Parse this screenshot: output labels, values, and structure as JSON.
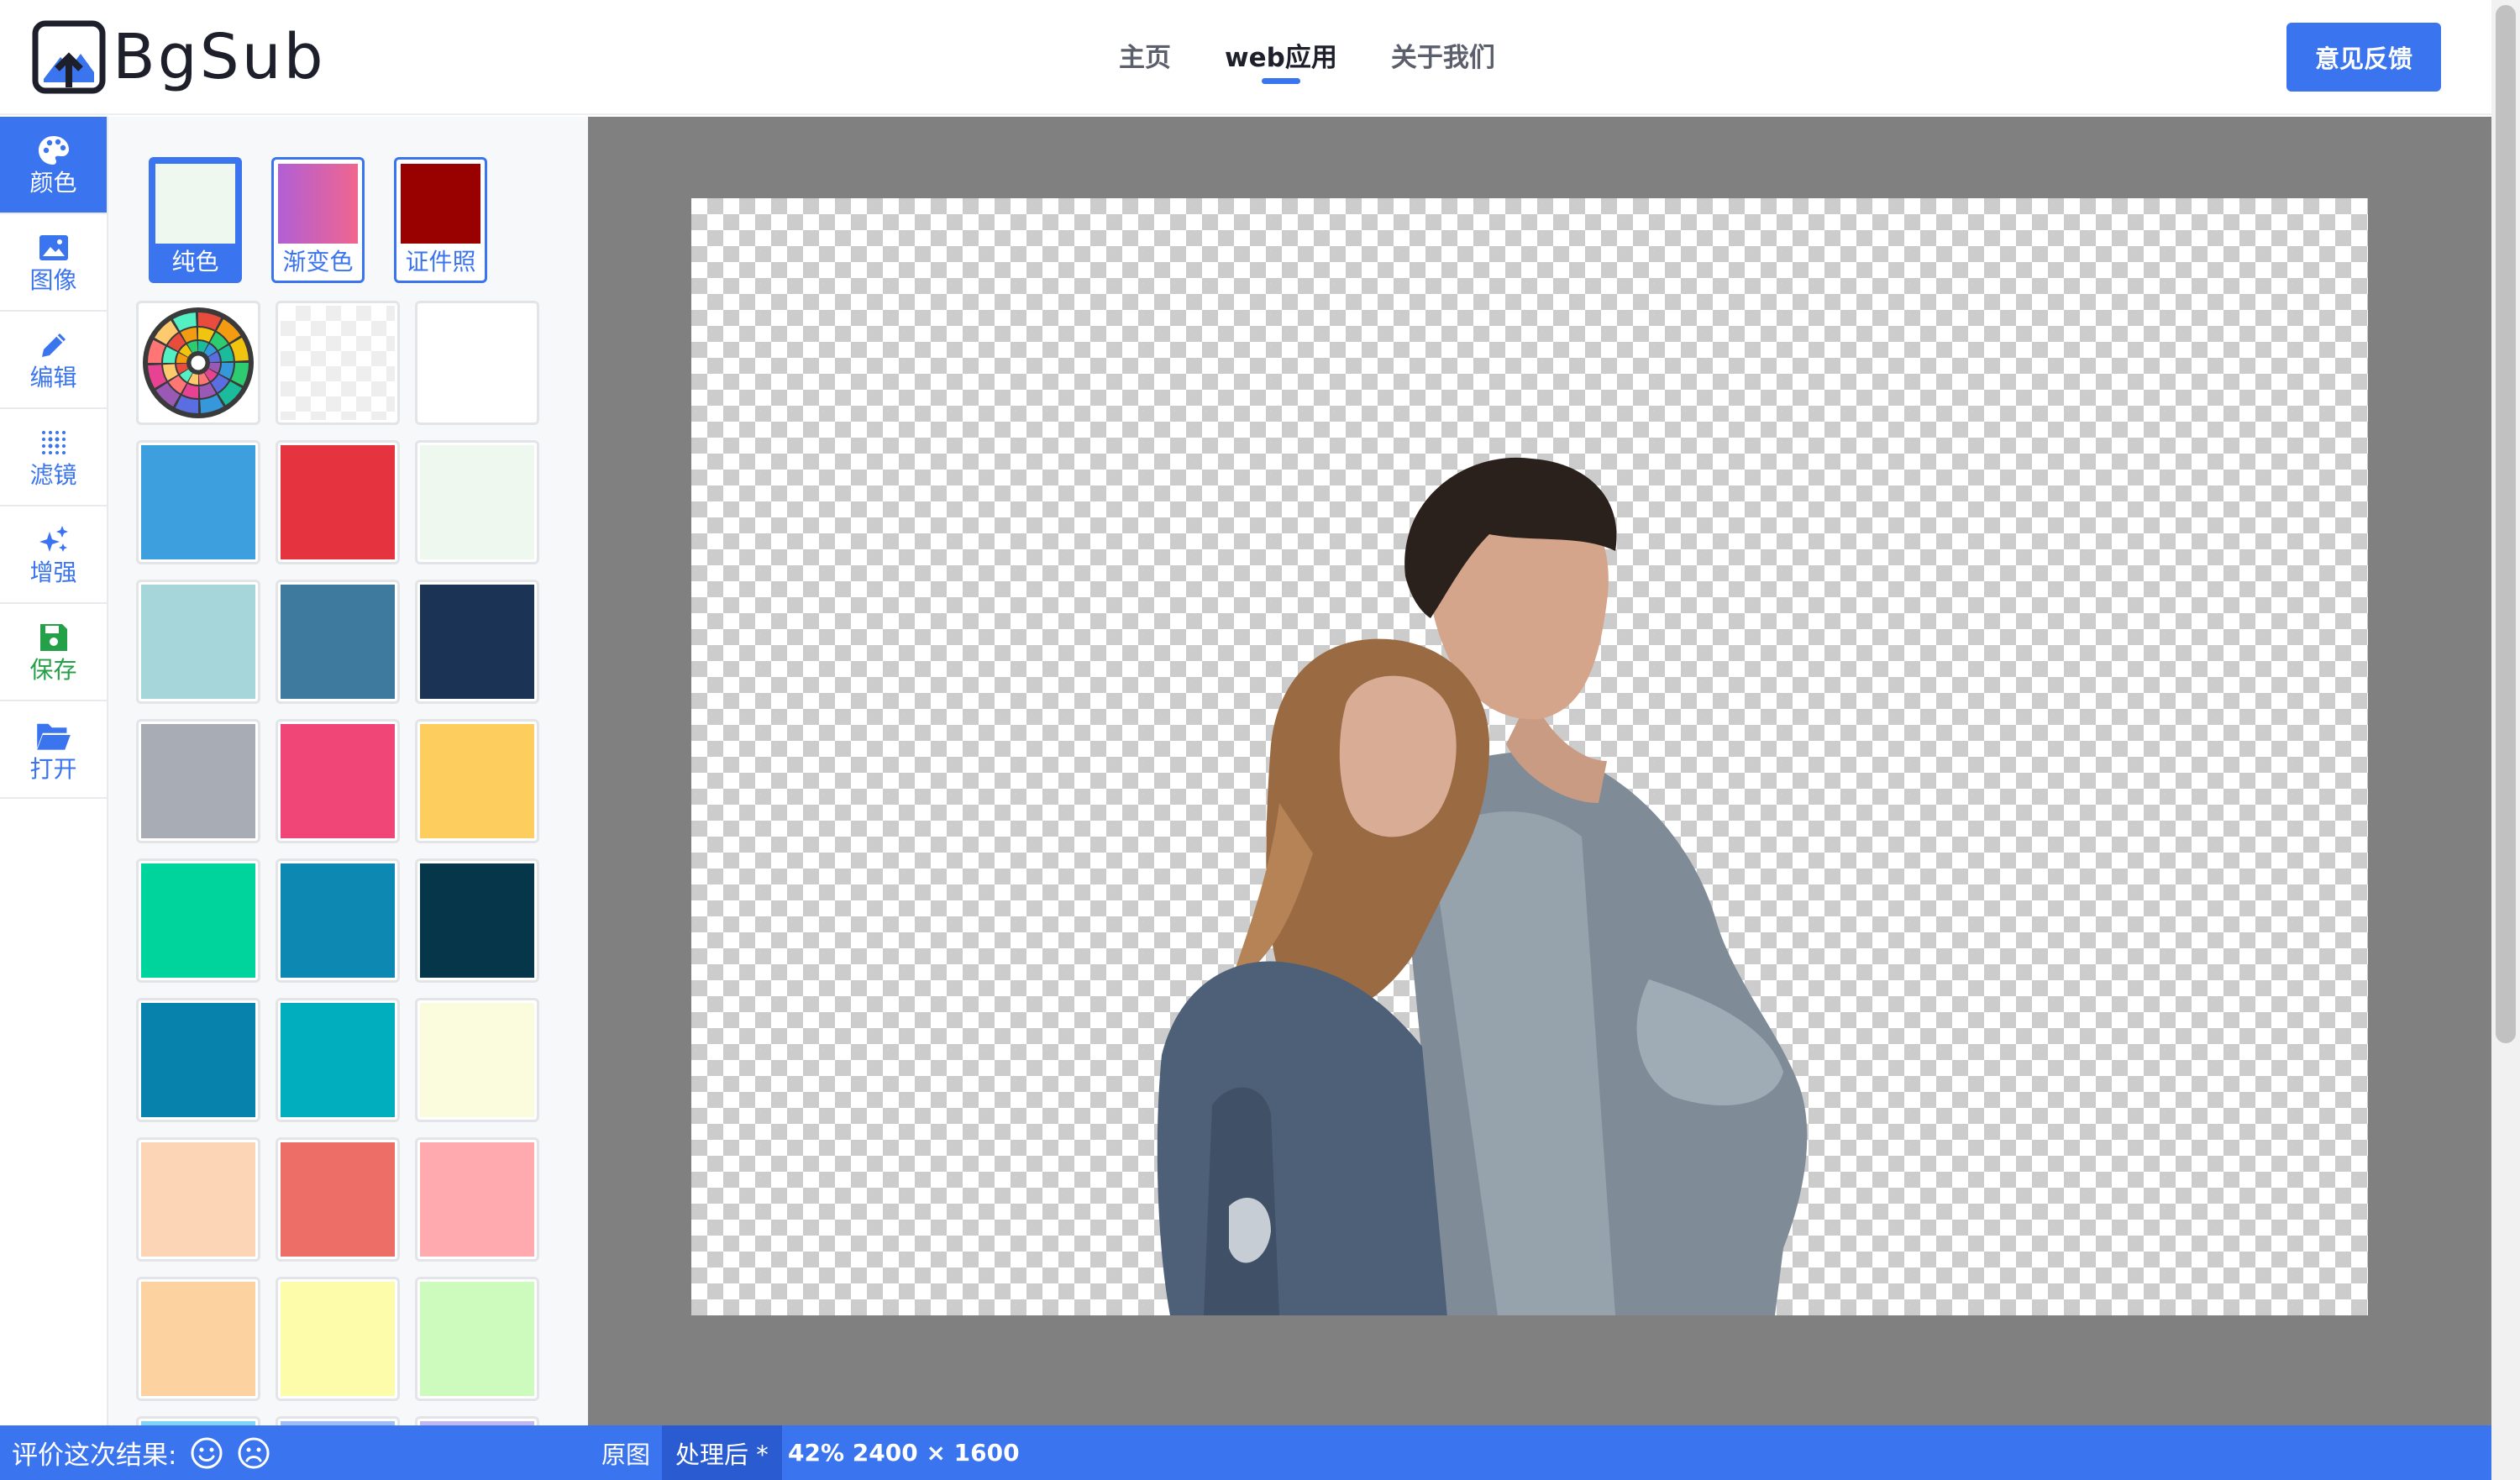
{
  "brand": {
    "name": "BgSub",
    "logo_icon": "upload-image-logo-icon"
  },
  "nav": {
    "items": [
      {
        "label": "主页",
        "active": false
      },
      {
        "label": "web应用",
        "active": true
      },
      {
        "label": "关于我们",
        "active": false
      }
    ],
    "feedback_label": "意见反馈"
  },
  "toolbar": {
    "items": [
      {
        "label": "颜色",
        "icon": "palette-icon",
        "active": true
      },
      {
        "label": "图像",
        "icon": "image-icon",
        "active": false
      },
      {
        "label": "编辑",
        "icon": "pencil-icon",
        "active": false
      },
      {
        "label": "滤镜",
        "icon": "dots-filter-icon",
        "active": false
      },
      {
        "label": "增强",
        "icon": "sparkle-icon",
        "active": false
      },
      {
        "label": "保存",
        "icon": "save-icon",
        "active": false
      },
      {
        "label": "打开",
        "icon": "folder-open-icon",
        "active": false
      }
    ]
  },
  "color_panel": {
    "tabs": [
      {
        "label": "纯色",
        "active": true,
        "swatch": "#eef8ef"
      },
      {
        "label": "渐变色",
        "active": false,
        "swatch": "gradient"
      },
      {
        "label": "证件照",
        "active": false,
        "swatch": "#990000"
      }
    ],
    "special_swatches": [
      "color-wheel",
      "transparent",
      "#ffffff"
    ],
    "swatches": [
      "#3d9fdd",
      "#e53340",
      "#eef8ef",
      "#a6d5da",
      "#3d7a9e",
      "#1b3355",
      "#a8adb5",
      "#ef4677",
      "#fdcd5e",
      "#00d49d",
      "#0d88b3",
      "#063649",
      "#0682ad",
      "#00aebd",
      "#fbfbdd",
      "#fcd5b7",
      "#ec6e66",
      "#feaaaf",
      "#fdd2a1",
      "#fcfcaa",
      "#cdfbbd"
    ],
    "partial_row": [
      "#7fd4f5",
      "#9ebdf5",
      "#c3b6f0"
    ],
    "colors": {
      "accent": "#3b74ef",
      "save_green": "#24a148",
      "panel_bg": "#f7f8fa",
      "stage_bg": "#808080"
    }
  },
  "bottom_bar": {
    "rating_label": "评价这次结果:",
    "good_icon": "smile-face-icon",
    "bad_icon": "frown-face-icon",
    "original_label": "原图",
    "processed_label": "处理后 *",
    "info": "42% 2400 × 1600"
  }
}
